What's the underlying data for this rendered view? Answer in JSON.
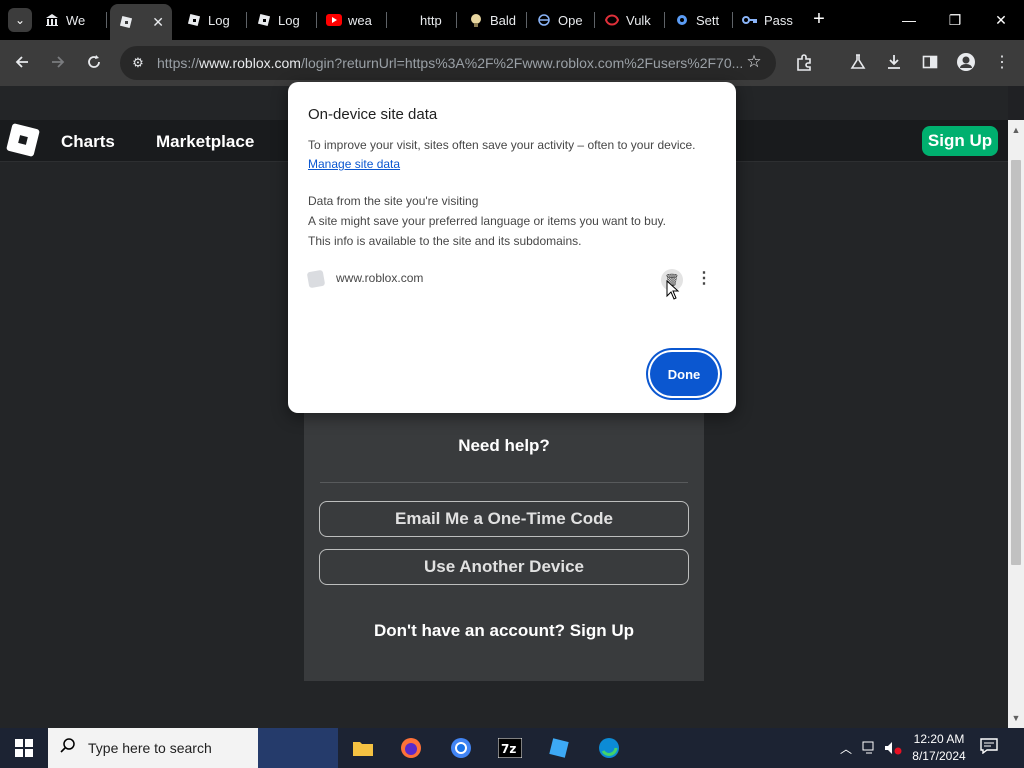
{
  "browser": {
    "tabs": [
      {
        "label": "We",
        "icon": "bank-icon"
      },
      {
        "label": "",
        "icon": "roblox-icon",
        "active": true
      },
      {
        "label": "Log",
        "icon": "roblox-icon"
      },
      {
        "label": "Log",
        "icon": "roblox-icon"
      },
      {
        "label": "wea",
        "icon": "youtube-icon"
      },
      {
        "label": "http",
        "icon": "blank-icon"
      },
      {
        "label": "Bald",
        "icon": "bald-icon"
      },
      {
        "label": "Ope",
        "icon": "openai-icon"
      },
      {
        "label": "Vulk",
        "icon": "vulkan-icon"
      },
      {
        "label": "Sett",
        "icon": "settings-icon"
      },
      {
        "label": "Pass",
        "icon": "key-icon"
      }
    ],
    "url_prefix": "https://",
    "url_host": "www.roblox.com",
    "url_rest": "/login?returnUrl=https%3A%2F%2Fwww.roblox.com%2Fusers%2F70..."
  },
  "roblox": {
    "nav": {
      "charts": "Charts",
      "marketplace": "Marketplace",
      "signup": "Sign Up"
    },
    "need_help": "Need help?",
    "email_btn": "Email Me a One-Time Code",
    "device_btn": "Use Another Device",
    "no_account": "Don't have an account? Sign Up"
  },
  "dialog": {
    "title": "On-device site data",
    "intro": "To improve your visit, sites often save your activity – often to your device.",
    "manage_link": "Manage site data",
    "section_heading": "Data from the site you're visiting",
    "line1": "A site might save your preferred language or items you want to buy.",
    "line2": "This info is available to the site and its subdomains.",
    "site": "www.roblox.com",
    "done": "Done"
  },
  "taskbar": {
    "search_placeholder": "Type here to search",
    "time": "12:20 AM",
    "date": "8/17/2024"
  },
  "colors": {
    "accent": "#0b57d0",
    "roblox_green": "#00b06f"
  }
}
